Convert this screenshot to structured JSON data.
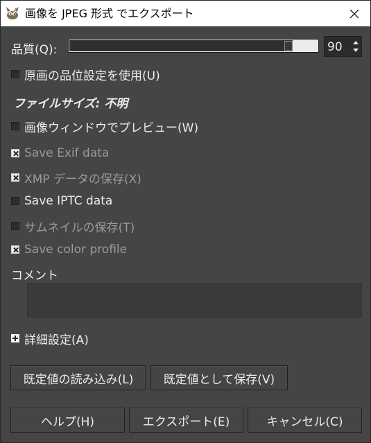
{
  "window": {
    "title": "画像を JPEG 形式 でエクスポート",
    "app_icon": "gimp-wilber-icon",
    "close_icon": "close-icon"
  },
  "quality": {
    "label": "品質(Q):",
    "value": "90",
    "level_percent": 90
  },
  "options": [
    {
      "label": "原画の品位設定を使用(U)",
      "checked": false,
      "enabled": true
    },
    {
      "label": "画像ウィンドウでプレビュー(W)",
      "checked": false,
      "enabled": true
    },
    {
      "label": "Save Exif data",
      "checked": true,
      "enabled": false
    },
    {
      "label": "XMP データの保存(X)",
      "checked": true,
      "enabled": false
    },
    {
      "label": "Save IPTC data",
      "checked": false,
      "enabled": true
    },
    {
      "label": "サムネイルの保存(T)",
      "checked": false,
      "enabled": false
    },
    {
      "label": "Save color profile",
      "checked": true,
      "enabled": false
    }
  ],
  "file_size": "ファイルサイズ: 不明",
  "comment": {
    "label": "コメント",
    "value": ""
  },
  "advanced": {
    "label": "詳細設定(A)"
  },
  "defaults": {
    "load_label": "既定値の読み込み(L)",
    "save_label": "既定値として保存(V)"
  },
  "actions": {
    "help_label": "ヘルプ(H)",
    "export_label": "エクスポート(E)",
    "cancel_label": "キャンセル(C)"
  },
  "colors": {
    "background": "#454545",
    "text": "#ececec",
    "disabled_text": "#9a9a9a"
  }
}
